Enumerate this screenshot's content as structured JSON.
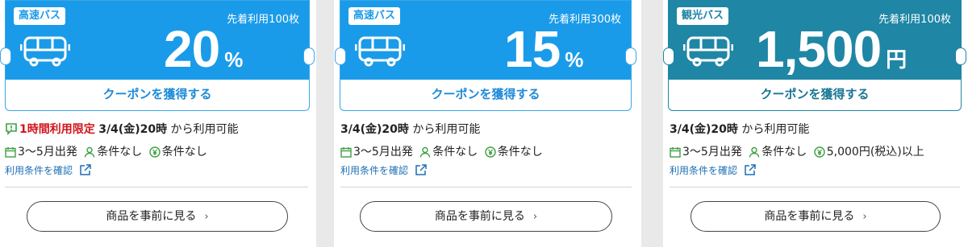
{
  "cards": [
    {
      "tag": "高速バス",
      "limit": "先着利用100枚",
      "amount": "20",
      "unit": "%",
      "get_label": "クーポンを獲得する",
      "limited": "1時間利用限定",
      "start": "3/4(金)20時",
      "avail_suffix": "から利用可能",
      "period": "3〜5月出発",
      "cond_person": "条件なし",
      "cond_price": "条件なし",
      "terms_link": "利用条件を確認",
      "view_label": "商品を事前に見る",
      "colors": {
        "band": "#1a9be9",
        "button_text": "#1d8ad8",
        "tag_text": "#1a9be9"
      }
    },
    {
      "tag": "高速バス",
      "limit": "先着利用300枚",
      "amount": "15",
      "unit": "%",
      "get_label": "クーポンを獲得する",
      "start": "3/4(金)20時",
      "avail_suffix": "から利用可能",
      "period": "3〜5月出発",
      "cond_person": "条件なし",
      "cond_price": "条件なし",
      "terms_link": "利用条件を確認",
      "view_label": "商品を事前に見る",
      "colors": {
        "band": "#1a9be9",
        "button_text": "#1d8ad8",
        "tag_text": "#1a9be9"
      }
    },
    {
      "tag": "観光バス",
      "limit": "先着利用100枚",
      "amount": "1,500",
      "unit": "円",
      "get_label": "クーポンを獲得する",
      "start": "3/4(金)20時",
      "avail_suffix": "から利用可能",
      "period": "3〜5月出発",
      "cond_person": "条件なし",
      "cond_price": "5,000円(税込)以上",
      "terms_link": "利用条件を確認",
      "view_label": "商品を事前に見る",
      "colors": {
        "band": "#1f86a5",
        "button_text": "#1a7594",
        "tag_text": "#1f86a5"
      }
    }
  ],
  "icons": {
    "bus": "bus-icon",
    "alert": "alert-icon",
    "calendar": "calendar-icon",
    "person": "person-icon",
    "yen": "yen-icon",
    "external": "external-link-icon",
    "chevron": "chevron-right-icon"
  }
}
